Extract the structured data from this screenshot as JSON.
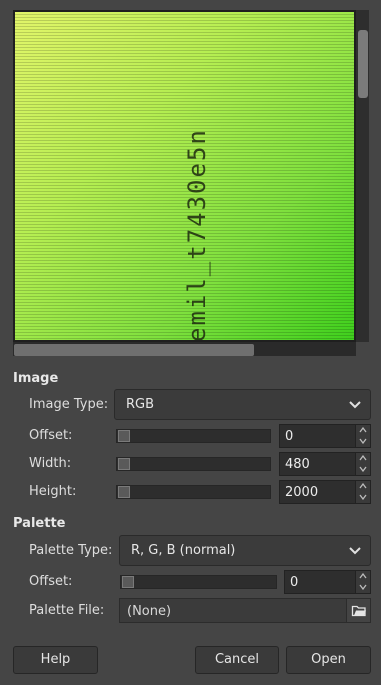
{
  "preview": {
    "text": "emil_t7430e5n"
  },
  "image": {
    "section_title": "Image",
    "image_type_label": "Image Type:",
    "image_type_value": "RGB",
    "offset_label": "Offset:",
    "offset_value": "0",
    "width_label": "Width:",
    "width_value": "480",
    "height_label": "Height:",
    "height_value": "2000"
  },
  "palette": {
    "section_title": "Palette",
    "palette_type_label": "Palette Type:",
    "palette_type_value": "R, G, B (normal)",
    "offset_label": "Offset:",
    "offset_value": "0",
    "file_label": "Palette File:",
    "file_value": "(None)"
  },
  "buttons": {
    "help": "Help",
    "cancel": "Cancel",
    "open": "Open"
  },
  "icons": {
    "chevron": "chevron-down-icon",
    "spin_up": "arrow-up-icon",
    "spin_down": "arrow-down-icon",
    "file_open": "document-open-icon"
  },
  "colors": {
    "background": "#454545",
    "preview_start": "#e2f56a",
    "preview_end": "#3fd01d"
  }
}
